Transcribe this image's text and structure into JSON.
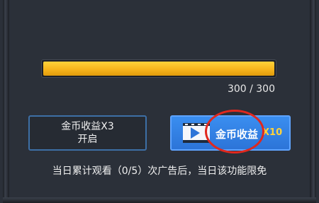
{
  "progress": {
    "current": 300,
    "max": 300,
    "fraction": 1.0,
    "text": "300 / 300",
    "fill_color": "#f7b51c"
  },
  "buttons": {
    "coin_x3": {
      "line1": "金币收益X3",
      "line2": "开启"
    },
    "ad_x10": {
      "label": "金币收益",
      "multiplier": "X10",
      "icon": "video-play-icon"
    }
  },
  "notice": "当日累计观看（0/5）次广告后，当日该功能限免",
  "colors": {
    "background": "#2b3039",
    "accent_blue": "#2c74d8",
    "highlight_circle": "#e0281e",
    "multiplier_gold": "#ffd23a"
  }
}
